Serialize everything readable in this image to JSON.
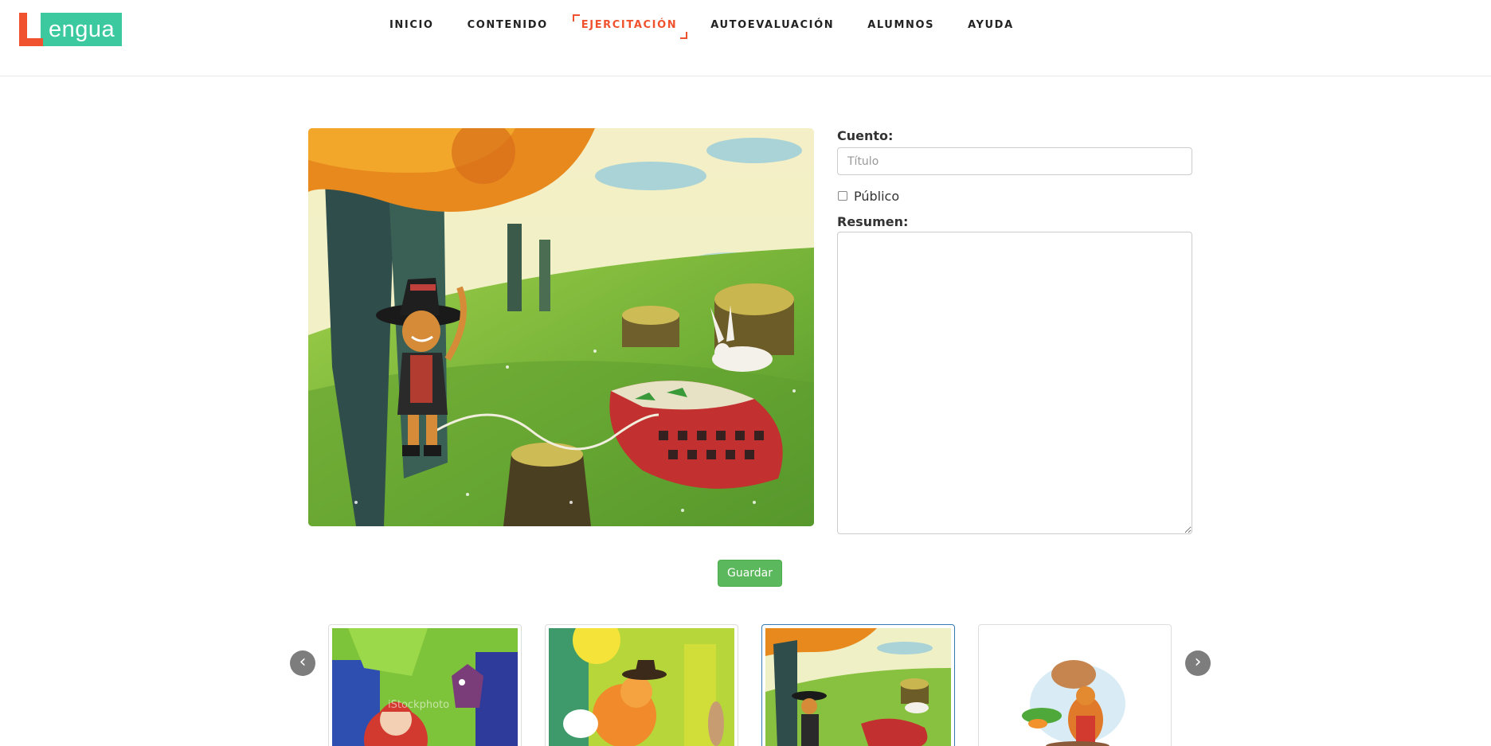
{
  "brand": {
    "letter": "L",
    "word": "engua",
    "colors": {
      "letter": "#f0522f",
      "word_bg": "#3dc99f"
    }
  },
  "nav": {
    "items": [
      {
        "label": "INICIO",
        "active": false
      },
      {
        "label": "CONTENIDO",
        "active": false
      },
      {
        "label": "EJERCITACIÓN",
        "active": true
      },
      {
        "label": "AUTOEVALUACIÓN",
        "active": false
      },
      {
        "label": "ALUMNOS",
        "active": false
      },
      {
        "label": "AYUDA",
        "active": false
      }
    ],
    "active_color": "#f0522f"
  },
  "form": {
    "cuento_label": "Cuento:",
    "titulo_placeholder": "Título",
    "titulo_value": "",
    "publico_label": "Público",
    "publico_checked": false,
    "resumen_label": "Resumen:",
    "resumen_value": ""
  },
  "actions": {
    "save_label": "Guardar",
    "save_color": "#5cb85c"
  },
  "carousel": {
    "prev_icon": "chevron-left-icon",
    "next_icon": "chevron-right-icon",
    "prev_glyph": "‹",
    "next_glyph": "›",
    "items": [
      {
        "name": "thumb-red-riding-hood",
        "watermark": "iStockphoto",
        "selected": false
      },
      {
        "name": "thumb-puss-in-boots-forest",
        "selected": false
      },
      {
        "name": "thumb-puss-in-boots-rabbit",
        "selected": true
      },
      {
        "name": "thumb-character-with-sack",
        "selected": false
      }
    ]
  }
}
